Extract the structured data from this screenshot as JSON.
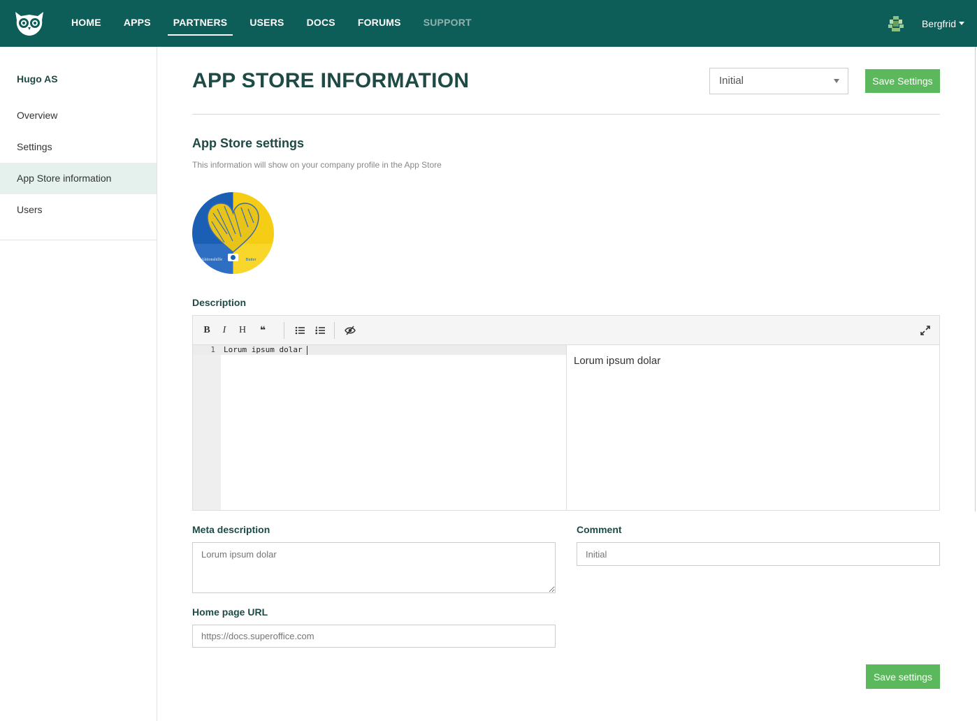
{
  "nav": {
    "items": [
      {
        "label": "HOME"
      },
      {
        "label": "APPS"
      },
      {
        "label": "PARTNERS"
      },
      {
        "label": "USERS"
      },
      {
        "label": "DOCS"
      },
      {
        "label": "FORUMS"
      },
      {
        "label": "SUPPORT"
      }
    ],
    "active": "PARTNERS",
    "user_name": "Bergfrid"
  },
  "sidebar": {
    "company": "Hugo AS",
    "items": [
      {
        "label": "Overview"
      },
      {
        "label": "Settings"
      },
      {
        "label": "App Store information"
      },
      {
        "label": "Users"
      }
    ],
    "active": "App Store information"
  },
  "main": {
    "title": "APP STORE INFORMATION",
    "status_select": "Initial",
    "save_top_label": "Save Settings",
    "section_title": "App Store settings",
    "section_subtitle": "This information will show on your company profile in the App Store",
    "logo_caption_left": "Aktionshilfe",
    "logo_caption_right": "Butter",
    "description_label": "Description",
    "editor": {
      "line_number": "1",
      "code": "Lorum ipsum dolar",
      "preview": "Lorum ipsum dolar",
      "toolbar": [
        "bold",
        "italic",
        "heading",
        "quote",
        "unordered-list",
        "ordered-list",
        "preview",
        "fullscreen"
      ]
    },
    "meta_label": "Meta description",
    "meta_placeholder": "Lorum ipsum dolar",
    "comment_label": "Comment",
    "comment_placeholder": "Initial",
    "homepage_label": "Home page URL",
    "homepage_placeholder": "https://docs.superoffice.com",
    "save_bottom_label": "Save settings"
  },
  "colors": {
    "header": "#0d5e58",
    "accent_green": "#5cb85c",
    "title_text": "#1d4a45",
    "sidebar_active": "#e4f1ed"
  }
}
